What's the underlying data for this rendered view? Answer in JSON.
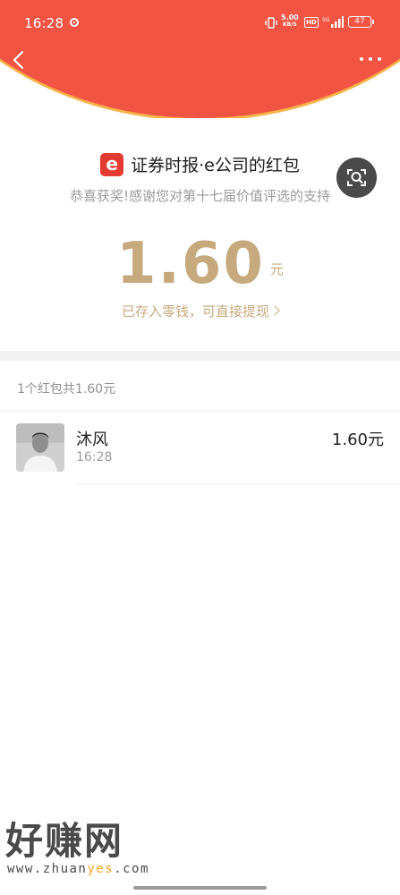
{
  "status_bar": {
    "time": "16:28",
    "net_speed_value": "5.00",
    "net_speed_unit": "KB/S",
    "hd_label": "HD",
    "signal_label": "5G",
    "battery": "47"
  },
  "header": {
    "back_icon": "chevron-left-icon",
    "more_icon": "more-dots-icon",
    "bg_color": "#f25443"
  },
  "packet": {
    "sender_logo_icon": "e-company-logo-icon",
    "sender_name": "证券时报·e公司的红包",
    "blessing": "恭喜获奖!感谢您对第十七届价值评选的支持",
    "amount": "1.60",
    "unit": "元",
    "saved_note": "已存入零钱，可直接提现",
    "accent_color": "#c6a97d"
  },
  "scan_button_icon": "scan-search-icon",
  "summary": "1个红包共1.60元",
  "records": [
    {
      "name": "沐风",
      "time": "16:28",
      "amount": "1.60元"
    }
  ],
  "watermark": {
    "title": "好赚网",
    "url_prefix": "www.zhuan",
    "url_highlight": "yes",
    "url_suffix": ".com"
  }
}
